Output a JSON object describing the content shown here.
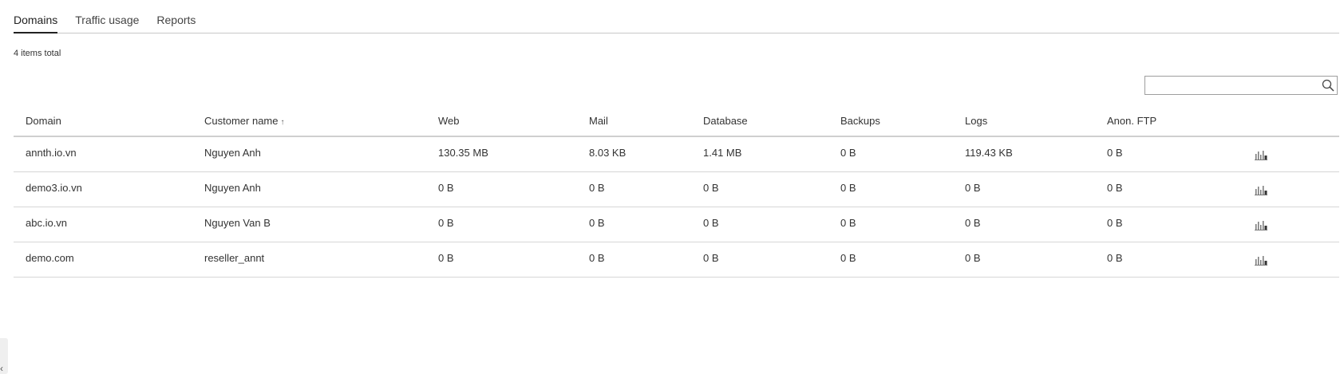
{
  "tabs": [
    {
      "label": "Domains",
      "active": true
    },
    {
      "label": "Traffic usage",
      "active": false
    },
    {
      "label": "Reports",
      "active": false
    }
  ],
  "items_total": "4 items total",
  "search": {
    "value": "",
    "placeholder": ""
  },
  "table": {
    "headers": {
      "domain": "Domain",
      "customer": "Customer name",
      "customer_sort": "↑",
      "web": "Web",
      "mail": "Mail",
      "database": "Database",
      "backups": "Backups",
      "logs": "Logs",
      "ftp": "Anon. FTP"
    },
    "rows": [
      {
        "domain": "annth.io.vn",
        "customer": "Nguyen Anh",
        "web": "130.35 MB",
        "mail": "8.03 KB",
        "database": "1.41 MB",
        "backups": "0 B",
        "logs": "119.43 KB",
        "ftp": "0 B",
        "icon": "bar-chart-icon"
      },
      {
        "domain": "demo3.io.vn",
        "customer": "Nguyen Anh",
        "web": "0 B",
        "mail": "0 B",
        "database": "0 B",
        "backups": "0 B",
        "logs": "0 B",
        "ftp": "0 B",
        "icon": "bar-chart-icon"
      },
      {
        "domain": "abc.io.vn",
        "customer": "Nguyen Van B",
        "web": "0 B",
        "mail": "0 B",
        "database": "0 B",
        "backups": "0 B",
        "logs": "0 B",
        "ftp": "0 B",
        "icon": "bar-chart-icon"
      },
      {
        "domain": "demo.com",
        "customer": "reseller_annt",
        "web": "0 B",
        "mail": "0 B",
        "database": "0 B",
        "backups": "0 B",
        "logs": "0 B",
        "ftp": "0 B",
        "icon": "bar-chart-icon"
      }
    ]
  },
  "collapse_handle": {
    "glyph": "‹",
    "icon": "chevron-left-icon"
  }
}
